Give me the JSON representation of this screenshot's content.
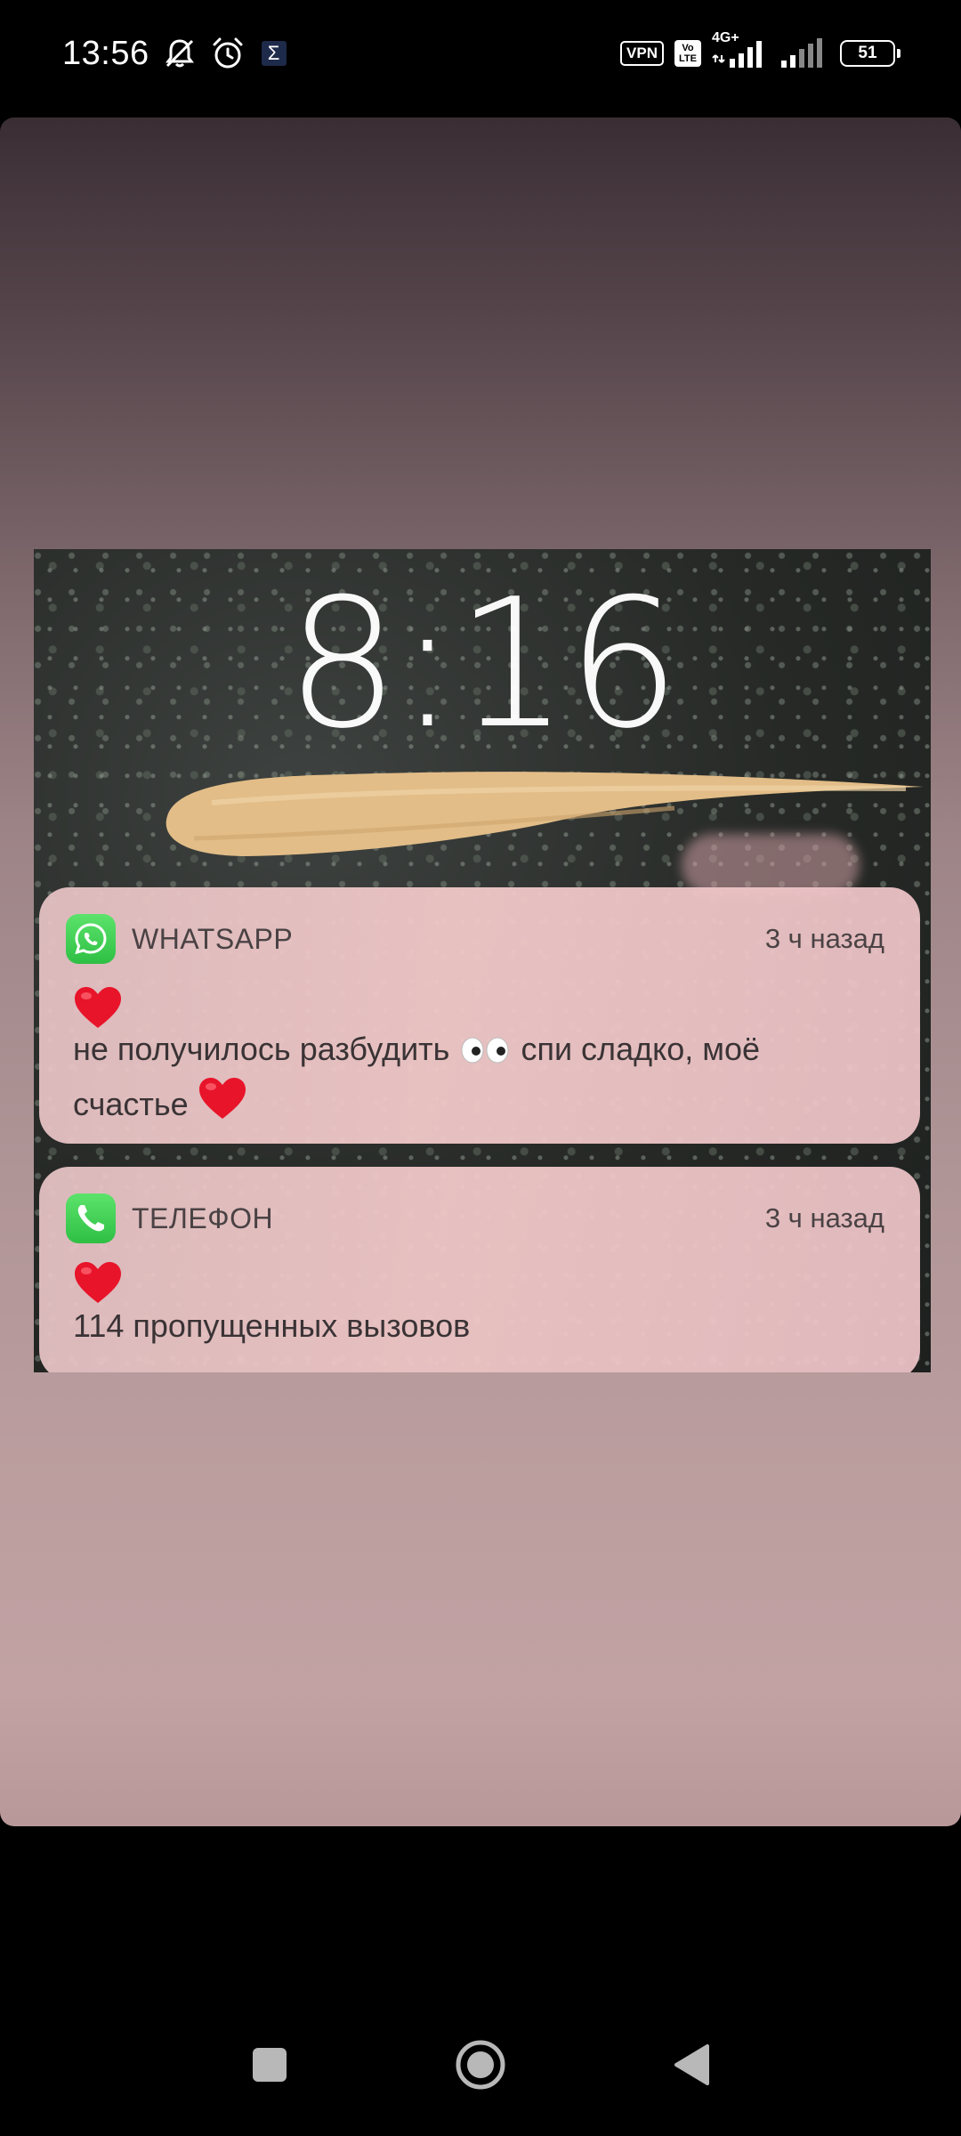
{
  "status_bar": {
    "time": "13:56",
    "icons": [
      "mute-icon",
      "alarm-icon",
      "sigma-app-icon"
    ],
    "sigma_glyph": "Σ",
    "vpn_label": "VPN",
    "volte_line1": "Vo",
    "volte_line2": "LTE",
    "network_label": "4G+",
    "battery_level": "51"
  },
  "photo": {
    "lock_time": "8:16",
    "notifications": [
      {
        "app": "WHATSAPP",
        "time": "3 ч назад",
        "line1": "не получилось разбудить",
        "line2": "спи сладко, моё",
        "line3": "счастье"
      },
      {
        "app": "ТЕЛЕФОН",
        "time": "3 ч назад",
        "body": "114 пропущенных вызовов"
      }
    ]
  },
  "nav_bar": {
    "buttons": [
      "recent-apps-button",
      "home-button",
      "back-button"
    ]
  },
  "colors": {
    "whatsapp_green": "#3fd158",
    "heart_red": "#e8142a",
    "scribble": "#e2bd88"
  }
}
